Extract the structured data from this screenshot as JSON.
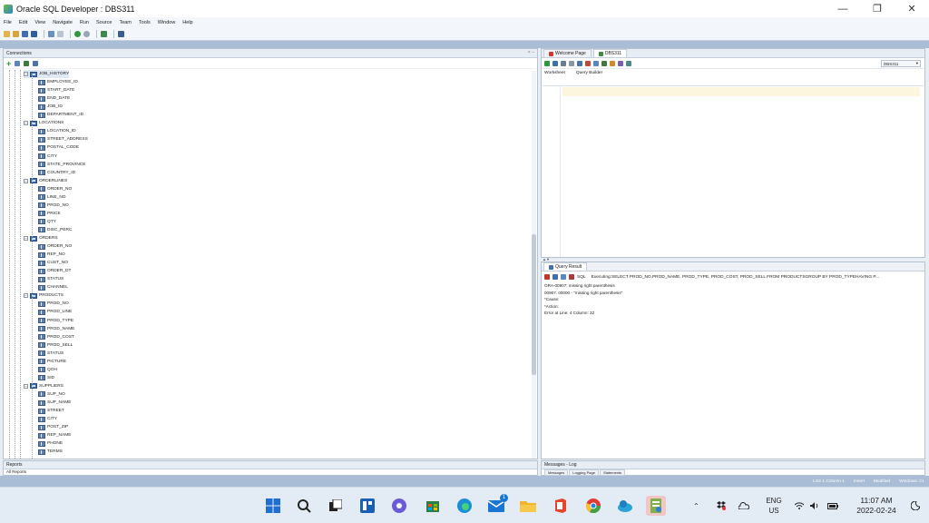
{
  "window": {
    "title": "Oracle SQL Developer : DBS311",
    "minimize": "—",
    "restore": "❐",
    "close": "✕"
  },
  "menu": [
    "File",
    "Edit",
    "View",
    "Navigate",
    "Run",
    "Source",
    "Team",
    "Tools",
    "Window",
    "Help"
  ],
  "connections_panel": {
    "title": "Connections",
    "controls": "× −"
  },
  "tree": [
    {
      "label": "JOB_HISTORY",
      "type": "table",
      "expanded": true
    },
    {
      "label": "EMPLOYEE_ID",
      "type": "column"
    },
    {
      "label": "START_DATE",
      "type": "column"
    },
    {
      "label": "END_DATE",
      "type": "column"
    },
    {
      "label": "JOB_ID",
      "type": "column"
    },
    {
      "label": "DEPARTMENT_ID",
      "type": "column"
    },
    {
      "label": "LOCATIONS",
      "type": "table",
      "expanded": true
    },
    {
      "label": "LOCATION_ID",
      "type": "column"
    },
    {
      "label": "STREET_ADDRESS",
      "type": "column"
    },
    {
      "label": "POSTAL_CODE",
      "type": "column"
    },
    {
      "label": "CITY",
      "type": "column"
    },
    {
      "label": "STATE_PROVINCE",
      "type": "column"
    },
    {
      "label": "COUNTRY_ID",
      "type": "column"
    },
    {
      "label": "ORDERLINES",
      "type": "table",
      "expanded": true
    },
    {
      "label": "ORDER_NO",
      "type": "column"
    },
    {
      "label": "LINE_NO",
      "type": "column"
    },
    {
      "label": "PROD_NO",
      "type": "column"
    },
    {
      "label": "PRICE",
      "type": "column"
    },
    {
      "label": "QTY",
      "type": "column"
    },
    {
      "label": "DISC_PERC",
      "type": "column"
    },
    {
      "label": "ORDERS",
      "type": "table",
      "expanded": true
    },
    {
      "label": "ORDER_NO",
      "type": "column"
    },
    {
      "label": "REP_NO",
      "type": "column"
    },
    {
      "label": "CUST_NO",
      "type": "column"
    },
    {
      "label": "ORDER_DT",
      "type": "column"
    },
    {
      "label": "STATUS",
      "type": "column"
    },
    {
      "label": "CHANNEL",
      "type": "column"
    },
    {
      "label": "PRODUCTS",
      "type": "table",
      "expanded": true
    },
    {
      "label": "PROD_NO",
      "type": "column"
    },
    {
      "label": "PROD_LINE",
      "type": "column"
    },
    {
      "label": "PROD_TYPE",
      "type": "column"
    },
    {
      "label": "PROD_NAME",
      "type": "column"
    },
    {
      "label": "PROD_COST",
      "type": "column"
    },
    {
      "label": "PROD_SELL",
      "type": "column"
    },
    {
      "label": "STATUS",
      "type": "column"
    },
    {
      "label": "PICTURE",
      "type": "column"
    },
    {
      "label": "QOH",
      "type": "column"
    },
    {
      "label": "SID",
      "type": "column"
    },
    {
      "label": "SUPPLIERS",
      "type": "table",
      "expanded": true
    },
    {
      "label": "SUP_NO",
      "type": "column"
    },
    {
      "label": "SUP_NAME",
      "type": "column"
    },
    {
      "label": "STREET",
      "type": "column"
    },
    {
      "label": "CITY",
      "type": "column"
    },
    {
      "label": "POST_ZIP",
      "type": "column"
    },
    {
      "label": "REP_NAME",
      "type": "column"
    },
    {
      "label": "PHONE",
      "type": "column"
    },
    {
      "label": "TERMS",
      "type": "column"
    }
  ],
  "reports_panel": {
    "title": "Reports",
    "item": "All Reports"
  },
  "editor": {
    "tabs": [
      {
        "label": "Welcome Page",
        "active": false
      },
      {
        "label": "DBS311",
        "active": true
      }
    ],
    "connection": "DBS311",
    "subtabs": [
      "Worksheet",
      "Query Builder"
    ]
  },
  "result": {
    "tab": "Query Result",
    "sql_label": "SQL",
    "executing": "Executing:SELECT PROD_NO,PROD_NAME, PROD_TYPE, PROD_COST, PROD_SELL FROM PRODUCTSGROUP BY PROD_TYPEHAVING P...",
    "messages": [
      "ORA-00907: missing right parenthesis",
      "00907. 00000 - \"missing right parenthesis\"",
      "*Cause:",
      "*Action:",
      "Error at Line: 4 Column: 32"
    ]
  },
  "log_panel": {
    "title": "Messages - Log",
    "tabs": [
      "Messages",
      "Logging Page",
      "Statements"
    ]
  },
  "statusbar": {
    "position": "Line 1 Column 1",
    "mode": "Insert",
    "state": "Modified",
    "platform": "Windows: CI"
  },
  "taskbar": {
    "lang_top": "ENG",
    "lang_bottom": "US",
    "time": "11:07 AM",
    "date": "2022-02-24",
    "mail_badge": "1"
  },
  "colors": {
    "accent": "#a9bdd6",
    "table_icon": "#3f6fb0",
    "editor_current_line": "#fbf6dd"
  }
}
